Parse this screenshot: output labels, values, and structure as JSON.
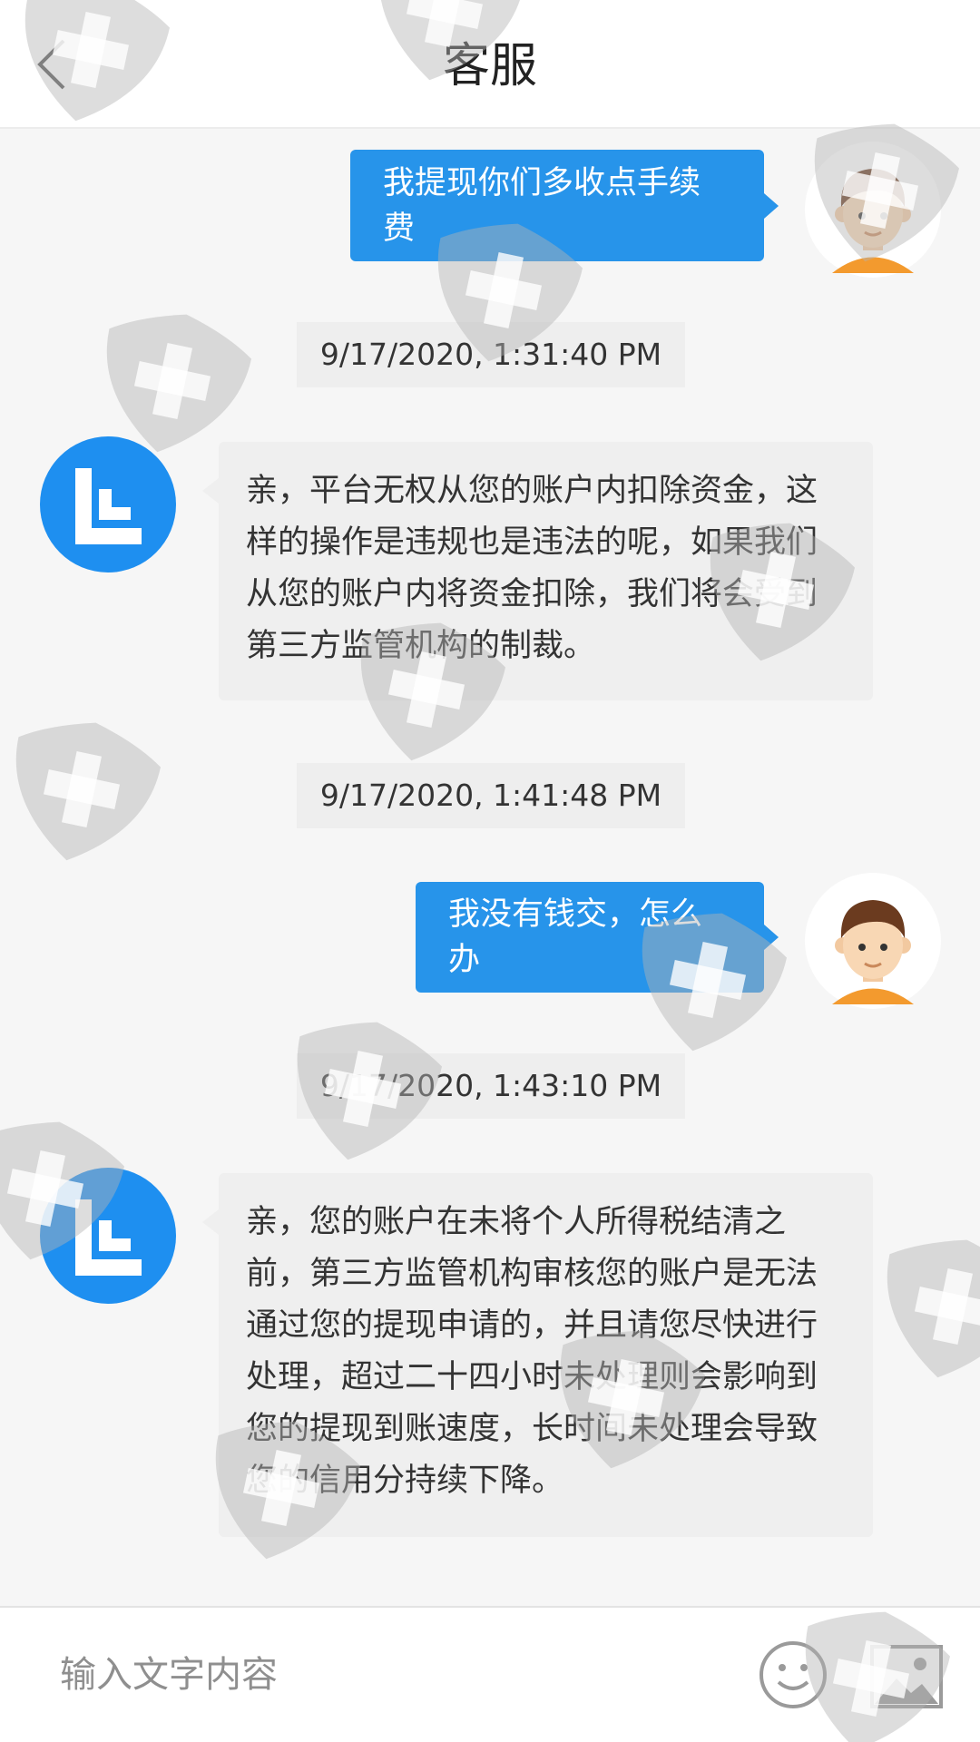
{
  "header": {
    "title": "客服",
    "back_icon": "chevron-left-icon"
  },
  "messages": [
    {
      "sender": "user",
      "text": "我提现你们多收点手续费"
    },
    {
      "type": "timestamp",
      "text": "9/17/2020, 1:31:40 PM"
    },
    {
      "sender": "agent",
      "text": "亲，平台无权从您的账户内扣除资金，这样的操作是违规也是违法的呢，如果我们从您的账户内将资金扣除，我们将会受到第三方监管机构的制裁。"
    },
    {
      "type": "timestamp",
      "text": "9/17/2020, 1:41:48 PM"
    },
    {
      "sender": "user",
      "text": "我没有钱交，怎么办"
    },
    {
      "type": "timestamp",
      "text": "9/17/2020, 1:43:10 PM"
    },
    {
      "sender": "agent",
      "text": "亲，您的账户在未将个人所得税结清之前，第三方监管机构审核您的账户是无法通过您的提现申请的，并且请您尽快进行处理，超过二十四小时未处理则会影响到您的提现到账速度，长时间未处理会导致您的信用分持续下降。"
    }
  ],
  "input_bar": {
    "placeholder": "输入文字内容",
    "emoji_icon": "smiley-icon",
    "image_icon": "image-icon"
  },
  "colors": {
    "user_bubble": "#2794ea",
    "agent_bubble": "#efefef",
    "agent_logo": "#1e8ff0",
    "background": "#f6f6f6",
    "watermark": "#b4b4b4"
  }
}
